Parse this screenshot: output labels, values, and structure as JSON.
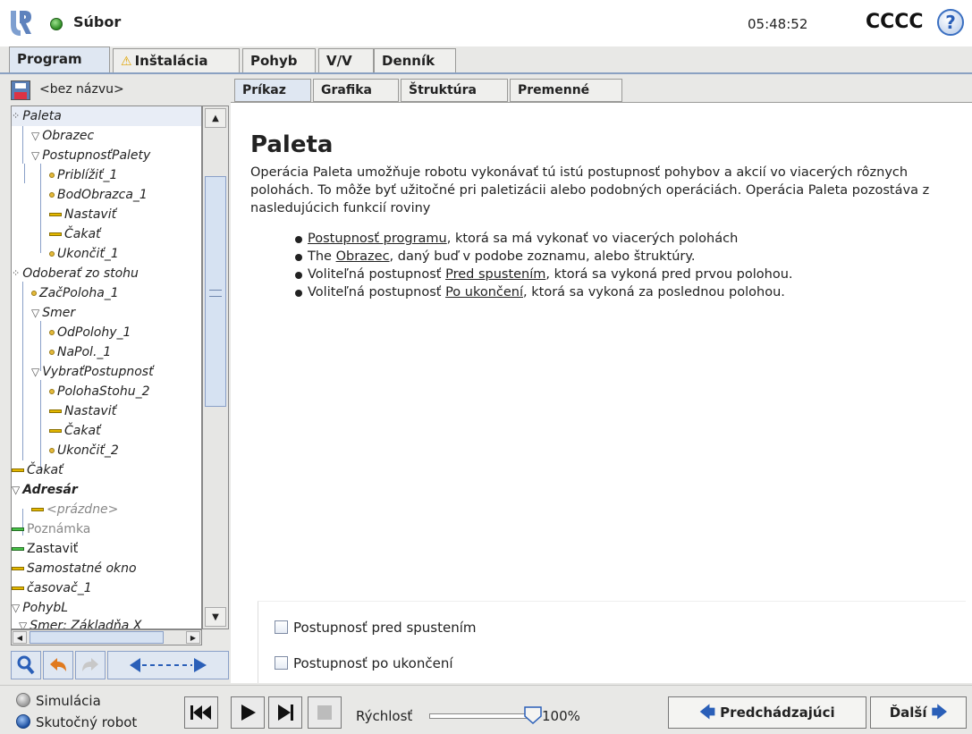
{
  "header": {
    "file_label": "Súbor",
    "clock": "05:48:52",
    "robot_name": "CCCC",
    "help": "?"
  },
  "main_tabs": [
    {
      "label": "Program",
      "active": true
    },
    {
      "label": "Inštalácia",
      "warning": true
    },
    {
      "label": "Pohyb"
    },
    {
      "label": "V/V"
    },
    {
      "label": "Denník"
    }
  ],
  "left": {
    "program_name": "<bez názvu>",
    "tree": [
      {
        "label": "Paleta",
        "icon": "pallet-icon",
        "selected": true
      },
      {
        "label": "Obrazec",
        "icon": "triangle-icon"
      },
      {
        "label": "PostupnosťPalety",
        "icon": "triangle-icon"
      },
      {
        "label": "Priblížiť_1",
        "icon": "waypoint-icon"
      },
      {
        "label": "BodObrazca_1",
        "icon": "waypoint-icon"
      },
      {
        "label": "Nastaviť",
        "icon": "bar-icon"
      },
      {
        "label": "Čakať",
        "icon": "bar-icon"
      },
      {
        "label": "Ukončiť_1",
        "icon": "waypoint-icon"
      },
      {
        "label": "Odoberať zo stohu",
        "icon": "pallet-icon"
      },
      {
        "label": "ZačPoloha_1",
        "icon": "waypoint-icon"
      },
      {
        "label": "Smer",
        "icon": "triangle-icon"
      },
      {
        "label": "OdPolohy_1",
        "icon": "waypoint-icon"
      },
      {
        "label": "NaPol._1",
        "icon": "waypoint-icon"
      },
      {
        "label": "VybraťPostupnosť",
        "icon": "triangle-icon"
      },
      {
        "label": "PolohaStohu_2",
        "icon": "waypoint-icon"
      },
      {
        "label": "Nastaviť",
        "icon": "bar-icon"
      },
      {
        "label": "Čakať",
        "icon": "bar-icon"
      },
      {
        "label": "Ukončiť_2",
        "icon": "waypoint-icon"
      },
      {
        "label": "Čakať",
        "icon": "bar-icon"
      },
      {
        "label": "Adresár",
        "icon": "triangle-icon"
      },
      {
        "label": "<prázdne>",
        "icon": "bar-icon"
      },
      {
        "label": "Poznámka",
        "icon": "green-bar-icon"
      },
      {
        "label": "Zastaviť",
        "icon": "green-bar-icon"
      },
      {
        "label": "Samostatné okno",
        "icon": "bar-icon"
      },
      {
        "label": "časovač_1",
        "icon": "bar-icon"
      },
      {
        "label": "PohybL",
        "icon": "triangle-icon"
      },
      {
        "label": "Smer: Základňa X",
        "icon": "triangle-icon"
      }
    ]
  },
  "sub_tabs": [
    {
      "label": "Príkaz",
      "active": true
    },
    {
      "label": "Grafika"
    },
    {
      "label": "Štruktúra"
    },
    {
      "label": "Premenné"
    }
  ],
  "content": {
    "title": "Paleta",
    "desc": "Operácia Paleta umožňuje robotu vykonávať tú istú postupnosť pohybov a akcií vo viacerých rôznych polohách. To môže byť užitočné pri paletizácii alebo podobných operáciách. Operácia Paleta pozostáva z nasledujúcich funkcií roviny",
    "b1_link": "Postupnosť programu",
    "b1_rest": ", ktorá sa má vykonať vo viacerých polohách",
    "b2_pre": "The ",
    "b2_link": "Obrazec",
    "b2_rest": ", daný buď v podobe zoznamu, alebo štruktúry.",
    "b3_pre": "Voliteľná postupnosť ",
    "b3_link": "Pred spustením",
    "b3_rest": ", ktorá sa vykoná pred prvou polohou.",
    "b4_pre": "Voliteľná postupnosť ",
    "b4_link": "Po ukončení",
    "b4_rest": ", ktorá sa vykoná za poslednou polohou.",
    "opt1": "Postupnosť pred spustením",
    "opt2": "Postupnosť po ukončení"
  },
  "bottom": {
    "mode_sim": "Simulácia",
    "mode_real": "Skutočný robot",
    "speed_label": "Rýchlosť",
    "speed_value": "100%",
    "prev": "Predchádzajúci",
    "next": "Ďalší"
  }
}
